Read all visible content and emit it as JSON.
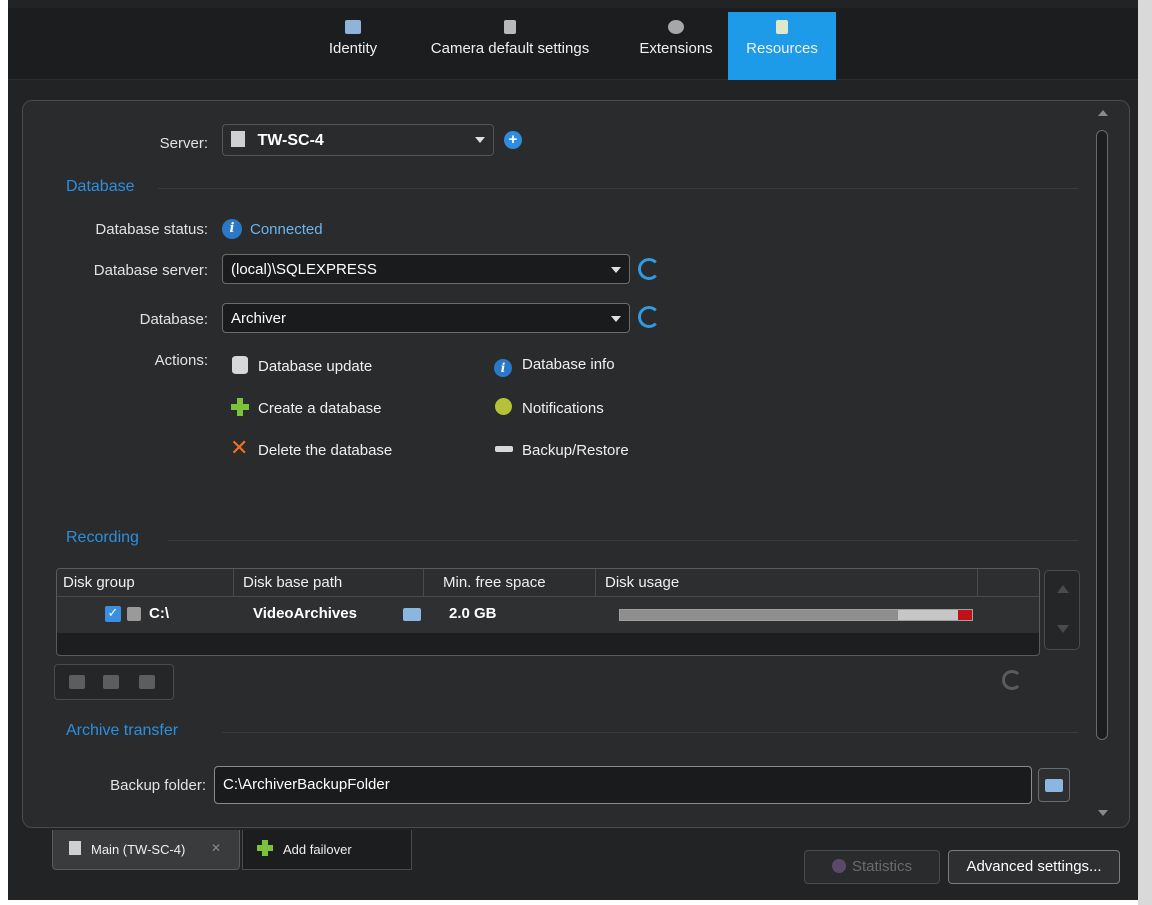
{
  "tabs": [
    {
      "label": "Identity",
      "icon": "identity-icon"
    },
    {
      "label": "Camera default settings",
      "icon": "camera-icon"
    },
    {
      "label": "Extensions",
      "icon": "extensions-icon"
    },
    {
      "label": "Resources",
      "icon": "resources-icon",
      "active": true
    }
  ],
  "server": {
    "label": "Server:",
    "value": "TW-SC-4"
  },
  "database_section": {
    "title": "Database",
    "status_label": "Database status:",
    "status_value": "Connected",
    "server_label": "Database server:",
    "server_value": "(local)\\SQLEXPRESS",
    "db_label": "Database:",
    "db_value": "Archiver",
    "actions_label": "Actions:",
    "actions": {
      "update": "Database update",
      "create": "Create a database",
      "delete": "Delete the database",
      "info": "Database info",
      "notifications": "Notifications",
      "backup": "Backup/Restore"
    }
  },
  "recording": {
    "title": "Recording",
    "columns": [
      "Disk group",
      "Disk base path",
      "Min. free space",
      "Disk usage"
    ],
    "rows": [
      {
        "disk": "C:\\",
        "path": "VideoArchives",
        "min_free": "2.0 GB",
        "checked": true
      }
    ]
  },
  "archive": {
    "title": "Archive transfer",
    "backup_label": "Backup folder:",
    "backup_value": "C:\\ArchiverBackupFolder"
  },
  "bottom": {
    "main_tab": "Main (TW-SC-4)",
    "add_failover": "Add failover",
    "statistics": "Statistics",
    "advanced": "Advanced settings..."
  },
  "colors": {
    "accent": "#1e9be8",
    "section_title": "#2d8fdd",
    "usage_critical": "#c0101a"
  }
}
